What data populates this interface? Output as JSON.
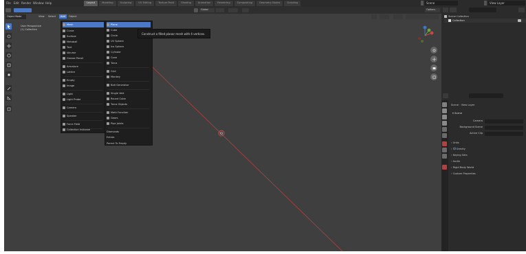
{
  "top_menu": [
    "File",
    "Edit",
    "Render",
    "Window",
    "Help"
  ],
  "workspace_tabs": [
    "Layout",
    "Modeling",
    "Sculpting",
    "UV Editing",
    "Texture Paint",
    "Shading",
    "Animation",
    "Rendering",
    "Compositing",
    "Geometry Nodes",
    "Scripting"
  ],
  "scene_name": "Scene",
  "view_layer_name": "View Layer",
  "header": {
    "mode": "Object Mode",
    "view": "View",
    "select": "Select",
    "add": "Add",
    "object": "Object",
    "orientation": "Global",
    "options": "Options"
  },
  "viewport_info": {
    "line1": "User Perspective",
    "line2": "(1) Collection"
  },
  "add_menu": [
    {
      "label": "Mesh",
      "has_sub": true,
      "highlight": true
    },
    {
      "label": "Curve",
      "has_sub": true
    },
    {
      "label": "Surface",
      "has_sub": true
    },
    {
      "label": "Metaball",
      "has_sub": true
    },
    {
      "label": "Text",
      "has_sub": false
    },
    {
      "label": "Volume",
      "has_sub": true
    },
    {
      "label": "Grease Pencil",
      "has_sub": true
    },
    {
      "label": "Armature",
      "has_sub": false
    },
    {
      "label": "Lattice",
      "has_sub": false
    },
    {
      "label": "Empty",
      "has_sub": true
    },
    {
      "label": "Image",
      "has_sub": true
    },
    {
      "label": "Light",
      "has_sub": true
    },
    {
      "label": "Light Probe",
      "has_sub": true
    },
    {
      "label": "Camera",
      "has_sub": false
    },
    {
      "label": "Speaker",
      "has_sub": false
    },
    {
      "label": "Force Field",
      "has_sub": true
    },
    {
      "label": "Collection Instance",
      "has_sub": true
    }
  ],
  "mesh_menu": [
    {
      "label": "Plane",
      "highlight": true
    },
    {
      "label": "Cube"
    },
    {
      "label": "Circle"
    },
    {
      "label": "UV Sphere"
    },
    {
      "label": "Ico Sphere"
    },
    {
      "label": "Cylinder"
    },
    {
      "label": "Cone"
    },
    {
      "label": "Torus"
    },
    {
      "label": "Grid"
    },
    {
      "label": "Monkey"
    },
    {
      "label": "Bolt Generator"
    },
    {
      "label": "Single Vert",
      "has_sub": true
    },
    {
      "label": "Round Cube"
    },
    {
      "label": "Torus Objects",
      "has_sub": true
    },
    {
      "label": "Math Function",
      "has_sub": true
    },
    {
      "label": "Gears",
      "has_sub": true
    },
    {
      "label": "Pipe Joints",
      "has_sub": true
    },
    {
      "label": "Diamonds",
      "has_sub": true
    },
    {
      "label": "Extras",
      "has_sub": true
    },
    {
      "label": "Parent To Empty"
    }
  ],
  "tooltip": "Construct a filled planar mesh with 4 vertices.",
  "outliner": {
    "root": "Scene Collection",
    "child": "Collection"
  },
  "properties": {
    "breadcrumb_scene": "Scene",
    "breadcrumb_layer": "View Layer",
    "section": "Scene",
    "rows": [
      {
        "label": "Camera"
      },
      {
        "label": "Background Scene"
      },
      {
        "label": "Active Clip"
      }
    ],
    "panels": [
      "Units",
      "Gravity",
      "Keying Sets",
      "Audio",
      "Rigid Body World",
      "Custom Properties"
    ]
  },
  "colors": {
    "accent": "#4c79c7",
    "viewport_bg": "#3f3f3f",
    "panel_bg": "#2b2b2b",
    "line": "#b04242"
  }
}
